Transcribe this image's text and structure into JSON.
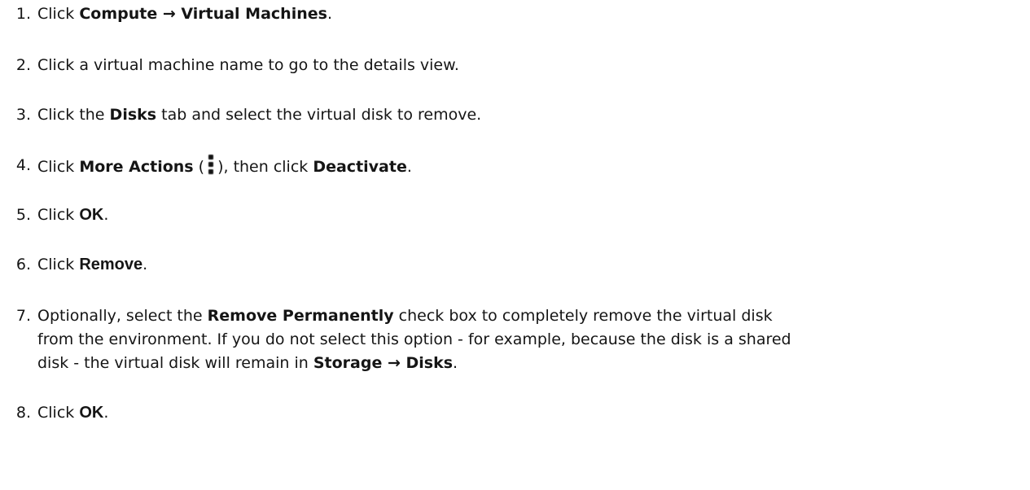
{
  "steps": [
    {
      "num": "1.",
      "t1": "Click ",
      "b1": "Compute → Virtual Machines",
      "t2": "."
    },
    {
      "num": "2.",
      "t1": "Click a virtual machine name to go to the details view."
    },
    {
      "num": "3.",
      "t1": "Click the ",
      "b1": "Disks",
      "t2": " tab and select the virtual disk to remove."
    },
    {
      "num": "4.",
      "t1": "Click ",
      "b1": "More Actions",
      "t2": " (",
      "icon": "kebab-vertical-icon",
      "t3": "), then click ",
      "b2": "Deactivate",
      "t4": "."
    },
    {
      "num": "5.",
      "t1": "Click ",
      "b1": "OK",
      "t2": "."
    },
    {
      "num": "6.",
      "t1": "Click ",
      "b1": "Remove",
      "t2": "."
    },
    {
      "num": "7.",
      "t1": "Optionally, select the ",
      "b1": "Remove Permanently",
      "t2": " check box to completely remove the virtual disk",
      "line2": "from the environment. If you do not select this option - for example, because the disk is a shared",
      "line3a": "disk - the virtual disk will remain in ",
      "b2": "Storage → Disks",
      "line3b": "."
    },
    {
      "num": "8.",
      "t1": "Click ",
      "b1": "OK",
      "t2": "."
    }
  ]
}
